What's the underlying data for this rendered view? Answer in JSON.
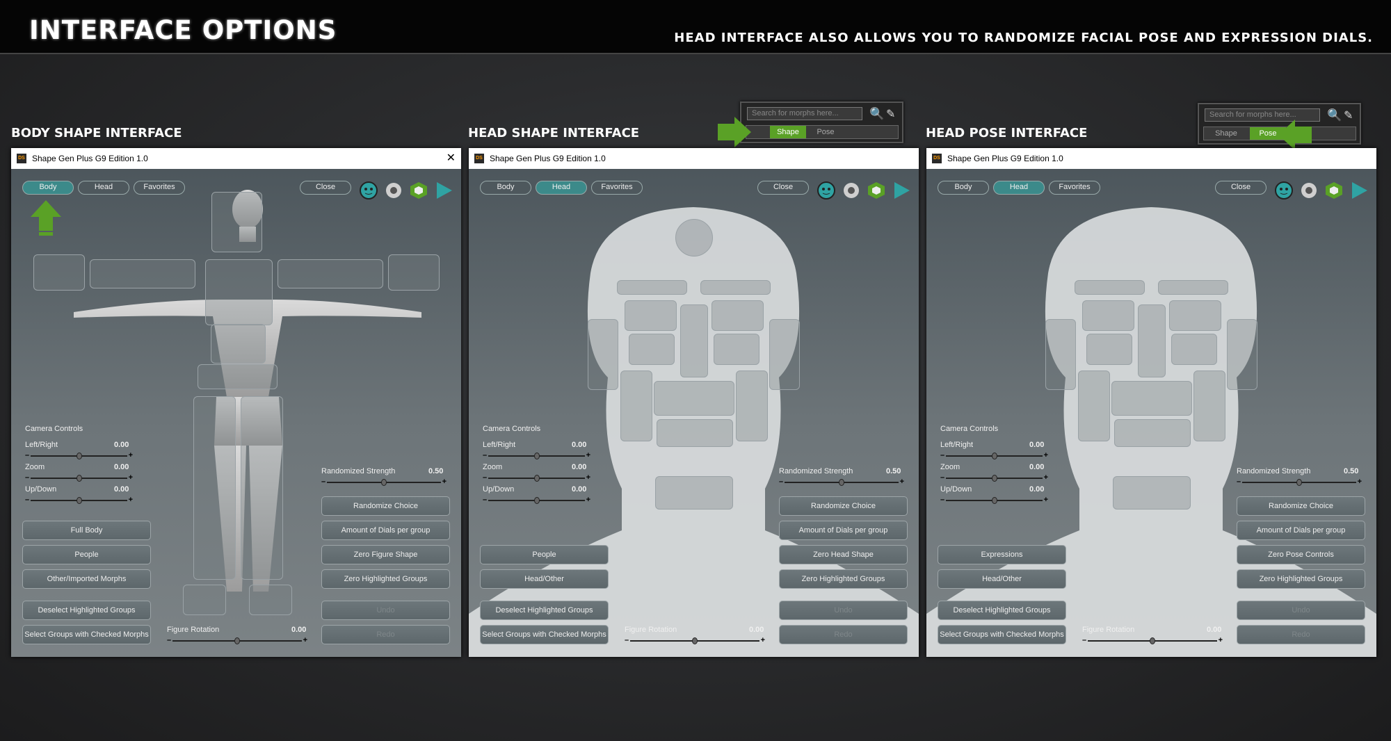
{
  "header": {
    "title": "INTERFACE OPTIONS",
    "tagline": "HEAD INTERFACE ALSO ALLOWS YOU TO RANDOMIZE FACIAL POSE AND EXPRESSION DIALS."
  },
  "sections": [
    "BODY SHAPE INTERFACE",
    "HEAD SHAPE INTERFACE",
    "HEAD POSE INTERFACE"
  ],
  "window_title": "Shape Gen Plus G9 Edition 1.0",
  "ds_badge": "DS",
  "tabs": {
    "body": "Body",
    "head": "Head",
    "favorites": "Favorites",
    "close": "Close"
  },
  "mini": {
    "placeholder": "Search for morphs here...",
    "shape": "Shape",
    "pose": "Pose"
  },
  "camera": {
    "title": "Camera Controls",
    "left_right": "Left/Right",
    "zoom": "Zoom",
    "up_down": "Up/Down",
    "lr_val": "0.00",
    "zoom_val": "0.00",
    "ud_val": "0.00"
  },
  "randomized": {
    "label": "Randomized Strength",
    "value": "0.50"
  },
  "rotation": {
    "label": "Figure Rotation",
    "value": "0.00"
  },
  "slider_level": {
    "camera": 0.5,
    "randomized": 0.5,
    "rotation": 0.5
  },
  "buttons": {
    "randomize": "Randomize Choice",
    "amount": "Amount of Dials per group",
    "zero_highlighted": "Zero Highlighted Groups",
    "undo": "Undo",
    "redo": "Redo",
    "zero_figure": "Zero Figure Shape",
    "zero_head": "Zero Head Shape",
    "zero_pose": "Zero Pose Controls",
    "full_body": "Full Body",
    "people": "People",
    "other": "Other/Imported Morphs",
    "head_other": "Head/Other",
    "expressions": "Expressions",
    "deselect": "Deselect Highlighted Groups",
    "select": "Select Groups with Checked Morphs"
  },
  "colors": {
    "accent": "#3c8a8a",
    "green": "#5aa126"
  }
}
